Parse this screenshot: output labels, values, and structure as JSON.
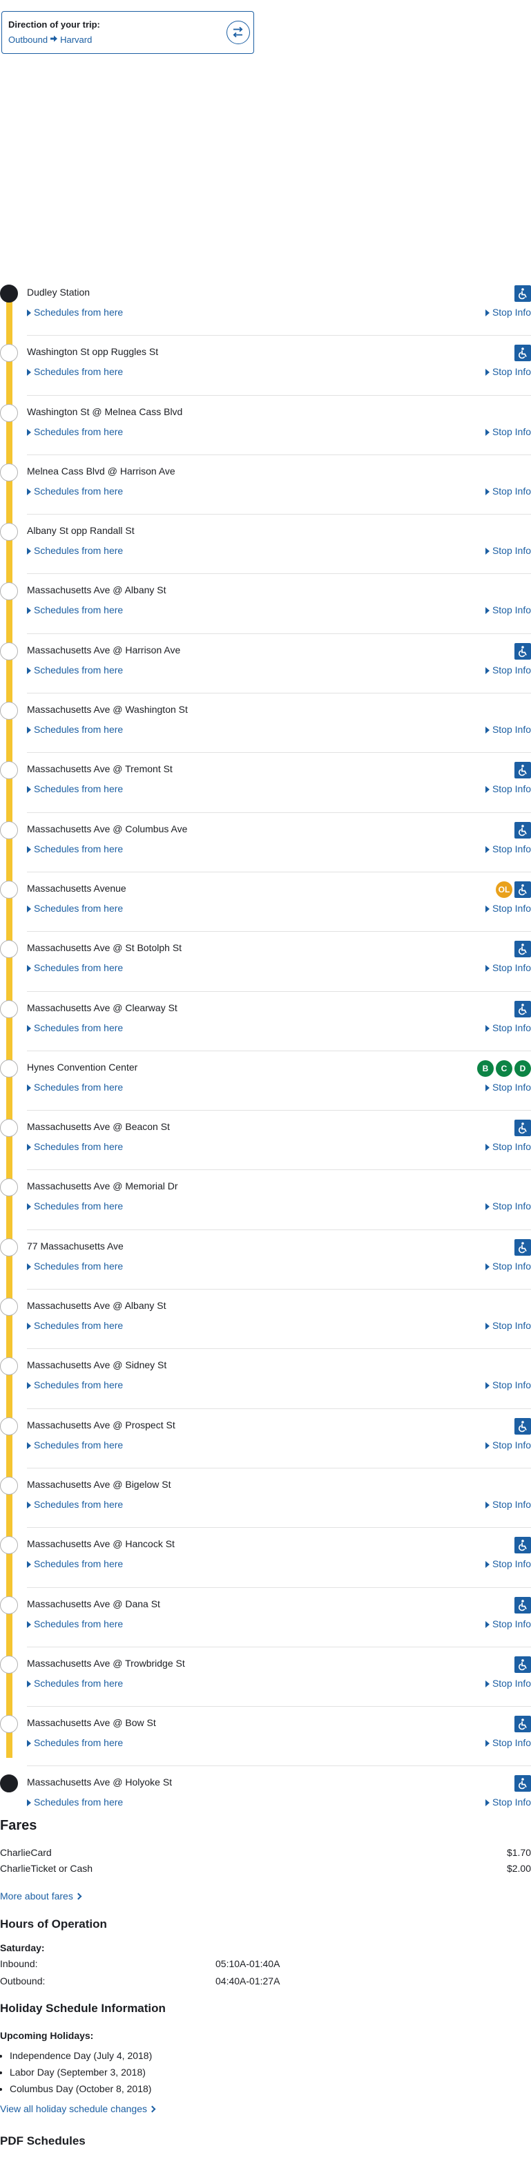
{
  "direction": {
    "label": "Direction of your trip:",
    "from": "Outbound",
    "to": "Harvard"
  },
  "stops": [
    {
      "name": "Dudley Station",
      "schedules": "Schedules from here",
      "info": "Stop Info",
      "terminus": true,
      "accessible": true,
      "badges": []
    },
    {
      "name": "Washington St opp Ruggles St",
      "schedules": "Schedules from here",
      "info": "Stop Info",
      "terminus": false,
      "accessible": true,
      "badges": []
    },
    {
      "name": "Washington St @ Melnea Cass Blvd",
      "schedules": "Schedules from here",
      "info": "Stop Info",
      "terminus": false,
      "accessible": false,
      "badges": []
    },
    {
      "name": "Melnea Cass Blvd @ Harrison Ave",
      "schedules": "Schedules from here",
      "info": "Stop Info",
      "terminus": false,
      "accessible": false,
      "badges": []
    },
    {
      "name": "Albany St opp Randall St",
      "schedules": "Schedules from here",
      "info": "Stop Info",
      "terminus": false,
      "accessible": false,
      "badges": []
    },
    {
      "name": "Massachusetts Ave @ Albany St",
      "schedules": "Schedules from here",
      "info": "Stop Info",
      "terminus": false,
      "accessible": false,
      "badges": []
    },
    {
      "name": "Massachusetts Ave @ Harrison Ave",
      "schedules": "Schedules from here",
      "info": "Stop Info",
      "terminus": false,
      "accessible": true,
      "badges": []
    },
    {
      "name": "Massachusetts Ave @ Washington St",
      "schedules": "Schedules from here",
      "info": "Stop Info",
      "terminus": false,
      "accessible": false,
      "badges": []
    },
    {
      "name": "Massachusetts Ave @ Tremont St",
      "schedules": "Schedules from here",
      "info": "Stop Info",
      "terminus": false,
      "accessible": true,
      "badges": []
    },
    {
      "name": "Massachusetts Ave @ Columbus Ave",
      "schedules": "Schedules from here",
      "info": "Stop Info",
      "terminus": false,
      "accessible": true,
      "badges": []
    },
    {
      "name": "Massachusetts Avenue",
      "schedules": "Schedules from here",
      "info": "Stop Info",
      "terminus": false,
      "accessible": true,
      "badges": [
        {
          "text": "OL",
          "color": "#e9a11c"
        }
      ]
    },
    {
      "name": "Massachusetts Ave @ St Botolph St",
      "schedules": "Schedules from here",
      "info": "Stop Info",
      "terminus": false,
      "accessible": true,
      "badges": []
    },
    {
      "name": "Massachusetts Ave @ Clearway St",
      "schedules": "Schedules from here",
      "info": "Stop Info",
      "terminus": false,
      "accessible": true,
      "badges": []
    },
    {
      "name": "Hynes Convention Center",
      "schedules": "Schedules from here",
      "info": "Stop Info",
      "terminus": false,
      "accessible": false,
      "badges": [
        {
          "text": "B",
          "color": "#0c8445"
        },
        {
          "text": "C",
          "color": "#0c8445"
        },
        {
          "text": "D",
          "color": "#0c8445"
        }
      ]
    },
    {
      "name": "Massachusetts Ave @ Beacon St",
      "schedules": "Schedules from here",
      "info": "Stop Info",
      "terminus": false,
      "accessible": true,
      "badges": []
    },
    {
      "name": "Massachusetts Ave @ Memorial Dr",
      "schedules": "Schedules from here",
      "info": "Stop Info",
      "terminus": false,
      "accessible": false,
      "badges": []
    },
    {
      "name": "77 Massachusetts Ave",
      "schedules": "Schedules from here",
      "info": "Stop Info",
      "terminus": false,
      "accessible": true,
      "badges": []
    },
    {
      "name": "Massachusetts Ave @ Albany St",
      "schedules": "Schedules from here",
      "info": "Stop Info",
      "terminus": false,
      "accessible": false,
      "badges": []
    },
    {
      "name": "Massachusetts Ave @ Sidney St",
      "schedules": "Schedules from here",
      "info": "Stop Info",
      "terminus": false,
      "accessible": false,
      "badges": []
    },
    {
      "name": "Massachusetts Ave @ Prospect St",
      "schedules": "Schedules from here",
      "info": "Stop Info",
      "terminus": false,
      "accessible": true,
      "badges": []
    },
    {
      "name": "Massachusetts Ave @ Bigelow St",
      "schedules": "Schedules from here",
      "info": "Stop Info",
      "terminus": false,
      "accessible": false,
      "badges": []
    },
    {
      "name": "Massachusetts Ave @ Hancock St",
      "schedules": "Schedules from here",
      "info": "Stop Info",
      "terminus": false,
      "accessible": true,
      "badges": []
    },
    {
      "name": "Massachusetts Ave @ Dana St",
      "schedules": "Schedules from here",
      "info": "Stop Info",
      "terminus": false,
      "accessible": true,
      "badges": []
    },
    {
      "name": "Massachusetts Ave @ Trowbridge St",
      "schedules": "Schedules from here",
      "info": "Stop Info",
      "terminus": false,
      "accessible": true,
      "badges": []
    },
    {
      "name": "Massachusetts Ave @ Bow St",
      "schedules": "Schedules from here",
      "info": "Stop Info",
      "terminus": false,
      "accessible": true,
      "badges": []
    },
    {
      "name": "Massachusetts Ave @ Holyoke St",
      "schedules": "Schedules from here",
      "info": "Stop Info",
      "terminus": true,
      "accessible": true,
      "badges": []
    }
  ],
  "fares": {
    "title": "Fares",
    "items": [
      {
        "label": "CharlieCard",
        "price": "$1.70"
      },
      {
        "label": "CharlieTicket or Cash",
        "price": "$2.00"
      }
    ],
    "more_link": "More about fares"
  },
  "hours": {
    "title": "Hours of Operation",
    "day": "Saturday:",
    "rows": [
      {
        "label": "Inbound:",
        "value": "05:10A-01:40A"
      },
      {
        "label": "Outbound:",
        "value": "04:40A-01:27A"
      }
    ]
  },
  "holidays": {
    "title": "Holiday Schedule Information",
    "upcoming_label": "Upcoming Holidays:",
    "items": [
      "Independence Day (July 4, 2018)",
      "Labor Day (September 3, 2018)",
      "Columbus Day (October 8, 2018)"
    ],
    "view_all_link": "View all holiday schedule changes"
  },
  "pdf": {
    "title": "PDF Schedules"
  },
  "colors": {
    "accent": "#1c5fa3",
    "route_line": "#f5c531",
    "orange_line": "#e9a11c",
    "green_line": "#0c8445"
  }
}
